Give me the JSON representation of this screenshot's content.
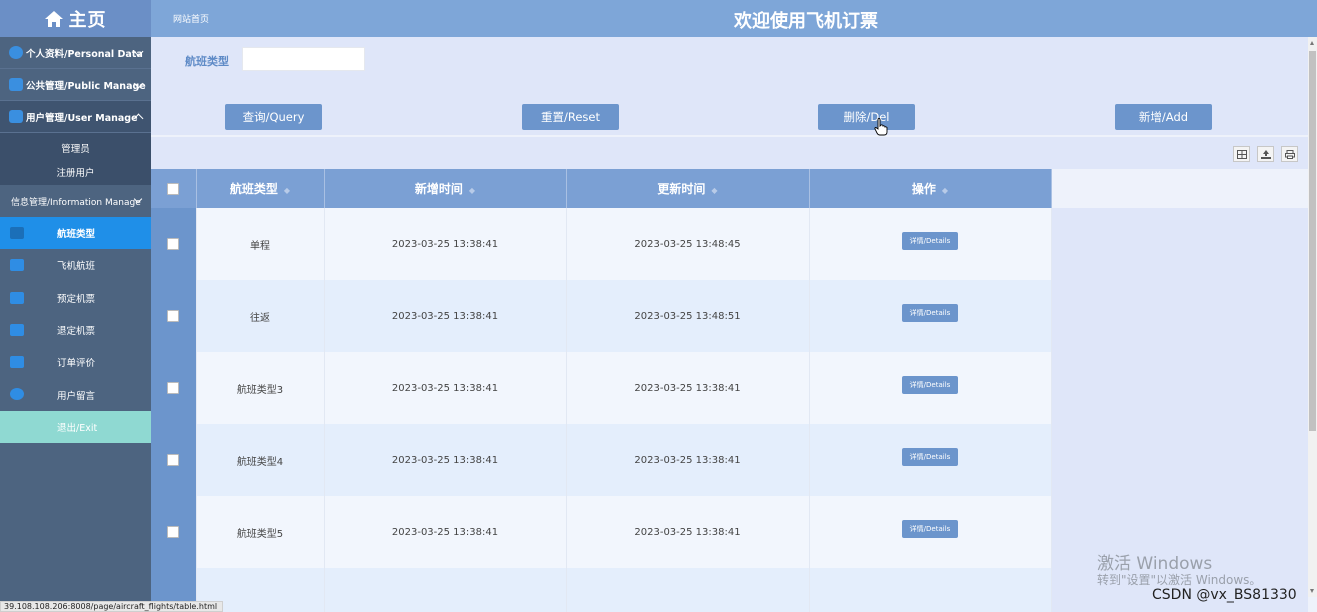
{
  "sidebar": {
    "home_label": "主页",
    "groups": [
      {
        "label": "个人资料/Personal Data",
        "icon": "person-icon"
      },
      {
        "label": "公共管理/Public Manage",
        "icon": "grid-icon"
      },
      {
        "label": "用户管理/User Manage",
        "icon": "users-icon"
      }
    ],
    "user_sub_items": [
      "管理员",
      "注册用户"
    ],
    "info_group_label": "信息管理/Information Manage",
    "info_items": [
      {
        "label": "航班类型",
        "icon": "pencil-icon",
        "active": true
      },
      {
        "label": "飞机航班",
        "icon": "tag-icon"
      },
      {
        "label": "预定机票",
        "icon": "users-icon"
      },
      {
        "label": "退定机票",
        "icon": "briefcase-icon"
      },
      {
        "label": "订单评价",
        "icon": "clipboard-icon"
      },
      {
        "label": "用户留言",
        "icon": "logout-icon"
      }
    ],
    "exit_label": "退出/Exit"
  },
  "header": {
    "home_link": "网站首页",
    "title": "欢迎使用飞机订票"
  },
  "search": {
    "label": "航班类型",
    "value": "",
    "buttons": {
      "query": "查询/Query",
      "reset": "重置/Reset",
      "delete": "删除/Del",
      "add": "新增/Add"
    }
  },
  "table": {
    "columns": [
      "航班类型",
      "新增时间",
      "更新时间",
      "操作"
    ],
    "rows": [
      {
        "type": "单程",
        "created": "2023-03-25 13:38:41",
        "updated": "2023-03-25 13:48:45",
        "action": "详情/Details"
      },
      {
        "type": "往返",
        "created": "2023-03-25 13:38:41",
        "updated": "2023-03-25 13:48:51",
        "action": "详情/Details"
      },
      {
        "type": "航班类型3",
        "created": "2023-03-25 13:38:41",
        "updated": "2023-03-25 13:38:41",
        "action": "详情/Details"
      },
      {
        "type": "航班类型4",
        "created": "2023-03-25 13:38:41",
        "updated": "2023-03-25 13:38:41",
        "action": "详情/Details"
      },
      {
        "type": "航班类型5",
        "created": "2023-03-25 13:38:41",
        "updated": "2023-03-25 13:38:41",
        "action": "详情/Details"
      }
    ]
  },
  "status": {
    "url": "39.108.108.206:8008/page/aircraft_flights/table.html"
  },
  "watermarks": {
    "windows_line1": "激活 Windows",
    "windows_line2": "转到\"设置\"以激活 Windows。",
    "csdn": "CSDN @vx_BS81330"
  },
  "colors": {
    "header": "#7ea6d8",
    "sidebar": "#4d6480",
    "active_item": "#1f8fe8",
    "button": "#6c95cc",
    "exit": "#8fd9d2"
  }
}
